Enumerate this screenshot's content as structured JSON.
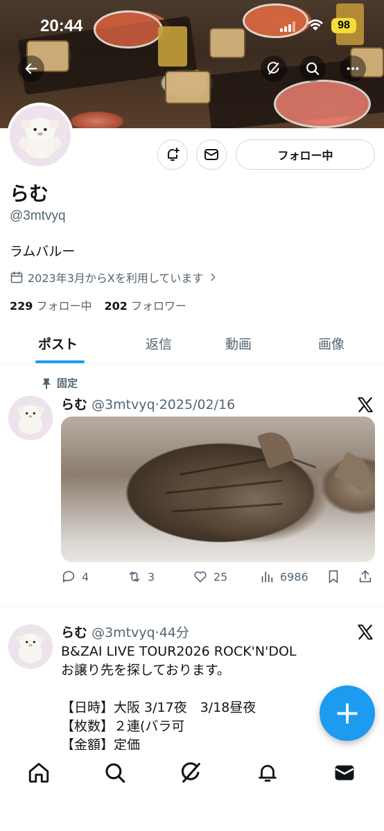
{
  "status_bar": {
    "time": "20:44",
    "battery": "98"
  },
  "header": {
    "back_icon": "arrow-left-icon",
    "grok_icon": "grok-icon",
    "search_icon": "search-icon",
    "more_icon": "more-horizontal-icon"
  },
  "profile": {
    "name": "らむ",
    "handle": "@3mtvyq",
    "bio": "ラムバルー",
    "joined": "2023年3月からXを利用しています",
    "following_count": "229",
    "following_label": "フォロー中",
    "followers_count": "202",
    "followers_label": "フォロワー",
    "follow_button": "フォロー中"
  },
  "tabs": [
    {
      "label": "ポスト",
      "active": true
    },
    {
      "label": "返信",
      "active": false
    },
    {
      "label": "動画",
      "active": false
    },
    {
      "label": "画像",
      "active": false
    }
  ],
  "posts": [
    {
      "pinned_label": "固定",
      "name": "らむ",
      "handle": "@3mtvyq",
      "dot": "·",
      "time": "2025/02/16",
      "replies": "4",
      "reposts": "3",
      "likes": "25",
      "views": "6986"
    },
    {
      "name": "らむ",
      "handle": "@3mtvyq",
      "dot": "·",
      "time": "44分",
      "lines": [
        "B&ZAI LIVE TOUR2026 ROCK'N'DOL",
        "お譲り先を探しております。",
        "",
        "【日時】大阪 3/17夜　3/18昼夜",
        "【枚数】２連(バラ可",
        "【金額】定価"
      ]
    }
  ],
  "fab": {
    "label": "+"
  },
  "colors": {
    "accent": "#1d9bf0",
    "text": "#0f1419",
    "muted": "#536471",
    "border": "#cfd9de"
  }
}
